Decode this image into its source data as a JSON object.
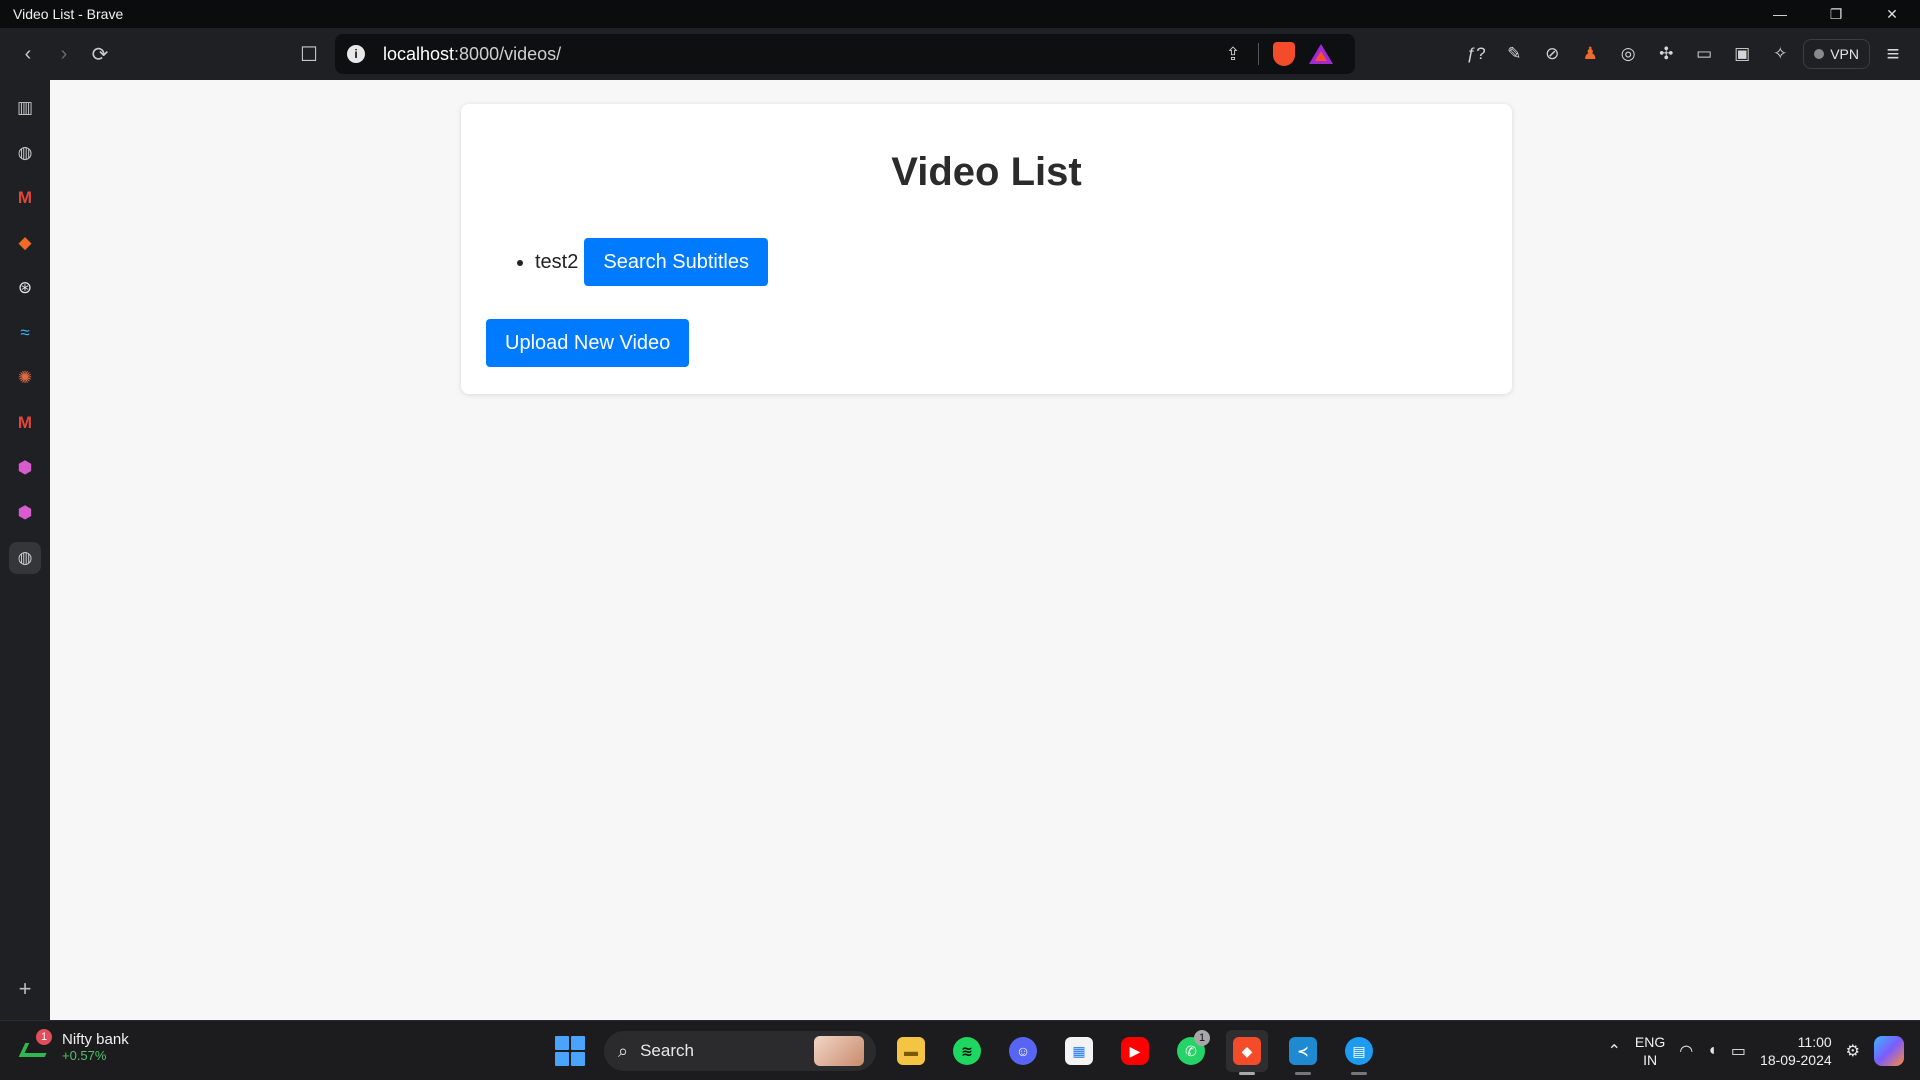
{
  "window": {
    "title": "Video List - Brave",
    "controls": {
      "minimize": "—",
      "restore": "❐",
      "close": "✕"
    }
  },
  "toolbar": {
    "back_icon": "‹",
    "forward_icon": "›",
    "reload_icon": "⟳",
    "bookmark_icon": "☐",
    "url_host": "localhost",
    "url_rest": ":8000/videos/",
    "info_icon": "i",
    "share_icon": "⇪",
    "vpn_label": "VPN",
    "tools": [
      "ƒ?",
      "✎",
      "⊘",
      "♟",
      "◎",
      "✣",
      "▭",
      "▣",
      "✧"
    ],
    "menu_icon": "≡"
  },
  "sidebar": {
    "items": [
      {
        "icon": "▥",
        "color": "#c9c9c9"
      },
      {
        "icon": "◍",
        "color": "#c9c9c9"
      },
      {
        "icon": "M",
        "color": "#e2463a"
      },
      {
        "icon": "◆",
        "color": "#f26b26"
      },
      {
        "icon": "⊛",
        "color": "#e9e9e9"
      },
      {
        "icon": "≈",
        "color": "#38bdf8"
      },
      {
        "icon": "✺",
        "color": "#e06b43"
      },
      {
        "icon": "M",
        "color": "#e2463a"
      },
      {
        "icon": "⬢",
        "color": "#d85bd0"
      },
      {
        "icon": "⬢",
        "color": "#d85bd0"
      },
      {
        "icon": "◍",
        "color": "#c9c9c9"
      }
    ],
    "add_icon": "+"
  },
  "page": {
    "heading": "Video List",
    "videos": [
      {
        "name": "test2",
        "action_label": "Search Subtitles"
      }
    ],
    "upload_label": "Upload New Video",
    "accent": "#007bff"
  },
  "taskbar": {
    "widget": {
      "badge": "1",
      "name": "Nifty bank",
      "change": "+0.57%"
    },
    "search_label": "Search",
    "search_icon": "⌕",
    "apps": [
      {
        "name": "file-explorer",
        "glyph": "▬",
        "bg": "#f4c542",
        "fg": "#7a5a00"
      },
      {
        "name": "spotify",
        "glyph": "≋",
        "bg": "#1ed760",
        "fg": "#0b0b0b"
      },
      {
        "name": "discord",
        "glyph": "☺",
        "bg": "#5865f2",
        "fg": "#ffffff"
      },
      {
        "name": "microsoft-store",
        "glyph": "▦",
        "bg": "#f3f3f3",
        "fg": "#1d7af3"
      },
      {
        "name": "youtube",
        "glyph": "▶",
        "bg": "#ff0000",
        "fg": "#ffffff"
      },
      {
        "name": "whatsapp",
        "glyph": "✆",
        "bg": "#25d366",
        "fg": "#ffffff",
        "notif": "1"
      },
      {
        "name": "brave",
        "glyph": "◆",
        "bg": "#f44b2a",
        "fg": "#ffffff",
        "active": true
      },
      {
        "name": "vscode",
        "glyph": "≺",
        "bg": "#1f8ad2",
        "fg": "#ffffff"
      },
      {
        "name": "docker",
        "glyph": "▤",
        "bg": "#1d9bf0",
        "fg": "#ffffff"
      }
    ],
    "tray": {
      "chevron": "⌃",
      "lang_top": "ENG",
      "lang_bottom": "IN",
      "wifi": "◠",
      "volume": "◖",
      "battery": "▭",
      "time": "11:00",
      "date": "18-09-2024",
      "settings": "⚙"
    }
  }
}
